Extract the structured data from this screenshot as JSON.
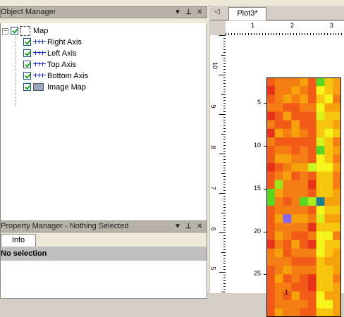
{
  "object_manager": {
    "title": "Object Manager",
    "tree": {
      "root": "Map",
      "children": [
        "Right Axis",
        "Left Axis",
        "Top Axis",
        "Bottom Axis",
        "Image Map"
      ]
    }
  },
  "property_manager": {
    "title": "Property Manager - Nothing Selected",
    "tab": "Info",
    "selection": "No selection"
  },
  "panel_controls": {
    "dropdown": "▼",
    "pin": "ᵖ",
    "close": "✕"
  },
  "plot": {
    "tab_label": "Plot3*",
    "ruler_h": [
      "1",
      "2",
      "3"
    ],
    "ruler_v": [
      "10",
      "9",
      "8",
      "7",
      "6",
      "5"
    ],
    "y_ticks": [
      "25",
      "20",
      "15",
      "10",
      "5"
    ],
    "x_tick": "1"
  },
  "colors": {
    "heat_low": "#e8321a",
    "heat_mid": "#f7a20c",
    "heat_high": "#f5f51c",
    "heat_green": "#59d61f",
    "heat_teal": "#1f7d8c",
    "heat_purple": "#8c64f0"
  },
  "chart_data": {
    "type": "heatmap",
    "title": "",
    "xlabel": "",
    "ylabel": "",
    "ylim": [
      0,
      28
    ],
    "y_ticks": [
      5,
      10,
      15,
      20,
      25
    ],
    "grid": false
  }
}
